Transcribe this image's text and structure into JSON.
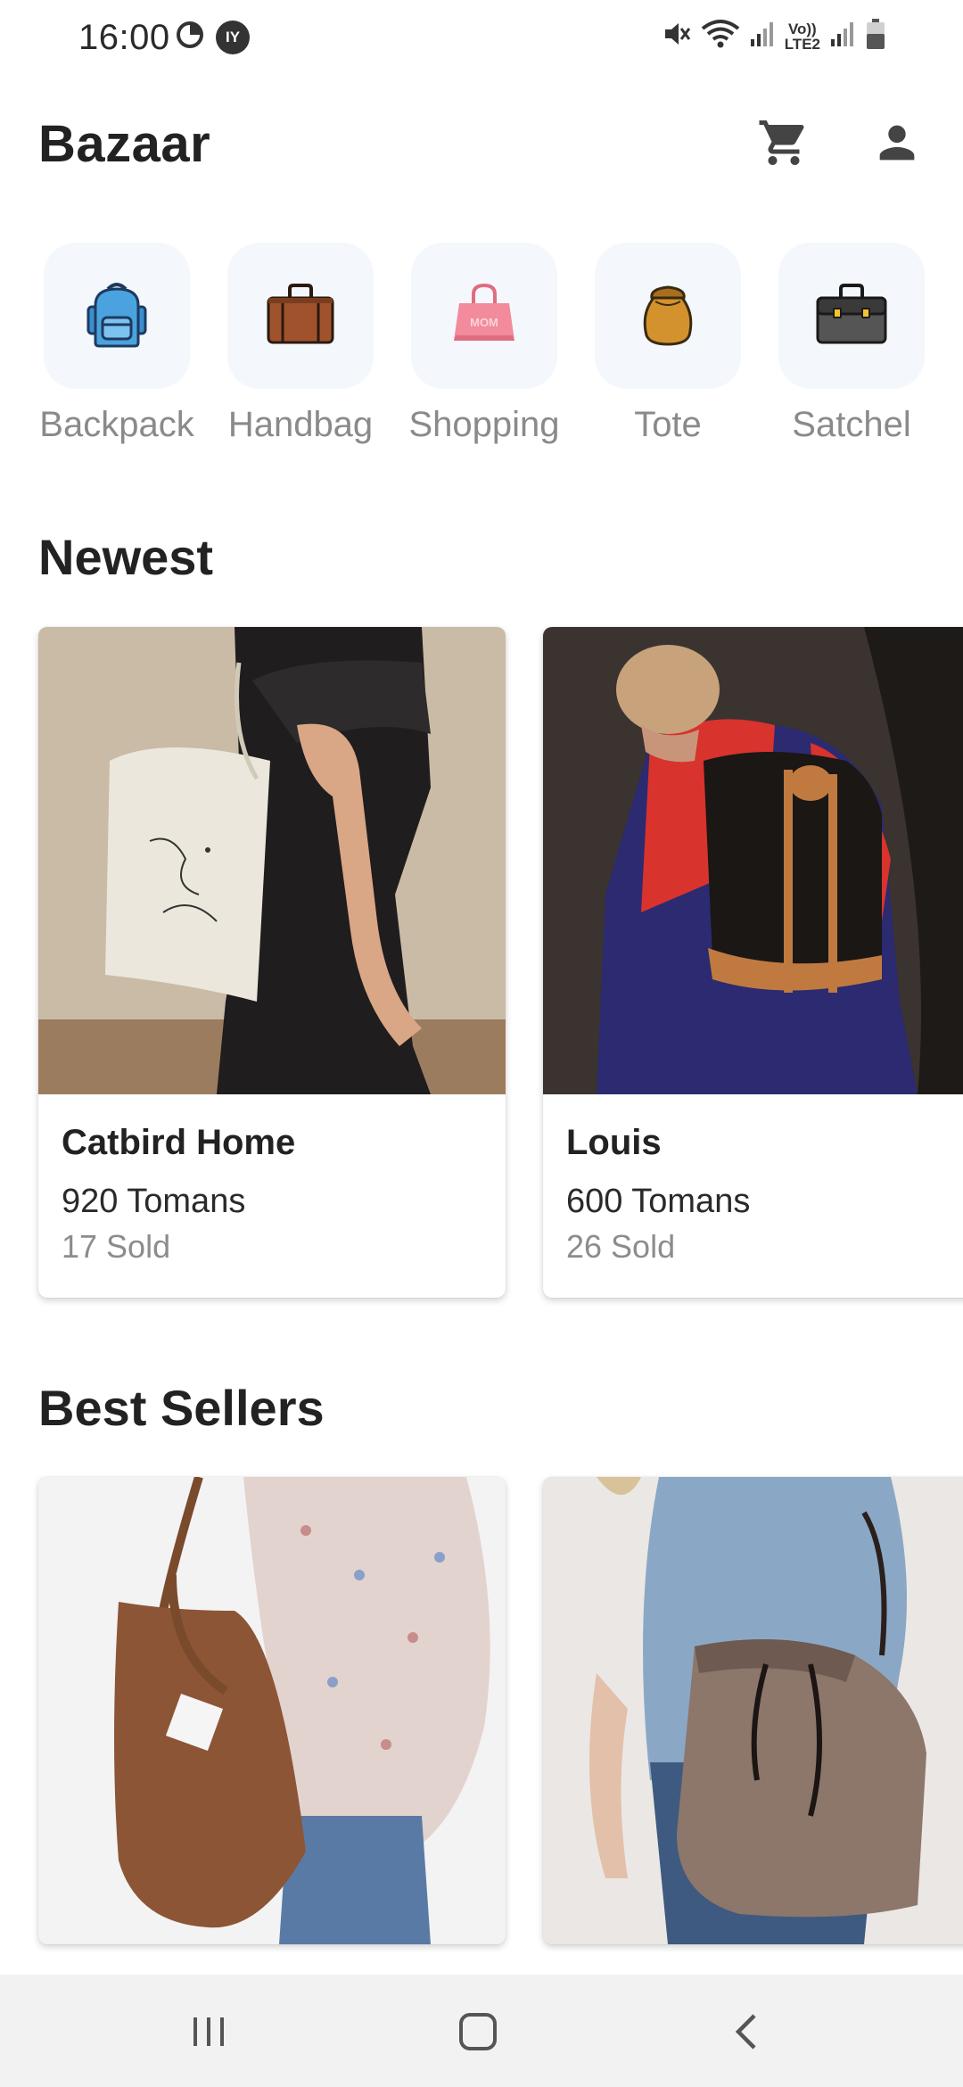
{
  "status_bar": {
    "time": "16:00",
    "left_icons": [
      "data-saver-icon",
      "profile-badge-icon"
    ],
    "badge_text": "IY",
    "right_icons": [
      "mute-icon",
      "wifi-icon",
      "signal-icon",
      "volte-icon",
      "signal-icon",
      "battery-icon"
    ],
    "lte_label_top": "Vo))",
    "lte_label_bottom": "LTE2"
  },
  "app_bar": {
    "title": "Bazaar",
    "actions": [
      "cart-icon",
      "account-icon"
    ]
  },
  "categories": [
    {
      "label": "Backpack",
      "icon": "backpack-icon",
      "color": "#4aa3df"
    },
    {
      "label": "Handbag",
      "icon": "handbag-icon",
      "color": "#a0522d"
    },
    {
      "label": "Shopping",
      "icon": "shopping-bag-icon",
      "color": "#f28b9b",
      "bag_text": "MOM"
    },
    {
      "label": "Tote",
      "icon": "tote-icon",
      "color": "#d4922e"
    },
    {
      "label": "Satchel",
      "icon": "satchel-icon",
      "color": "#555555"
    }
  ],
  "sections": {
    "newest": {
      "title": "Newest",
      "products": [
        {
          "name": "Catbird Home",
          "price": "920 Tomans",
          "sold": "17 Sold",
          "image": "white-tote-photo"
        },
        {
          "name": "Louis",
          "price": "600 Tomans",
          "sold": "26 Sold",
          "image": "black-backpack-photo"
        }
      ]
    },
    "best_sellers": {
      "title": "Best Sellers",
      "products": [
        {
          "image": "brown-corduroy-tote-photo"
        },
        {
          "image": "brown-leather-bucket-bag-photo"
        }
      ]
    }
  },
  "nav_bar": {
    "buttons": [
      "recents-icon",
      "home-icon",
      "back-icon"
    ]
  },
  "colors": {
    "background": "#ffffff",
    "category_tile": "#f4f8fc",
    "label_gray": "#8a8a8a",
    "nav_bar": "#f2f2f2"
  }
}
